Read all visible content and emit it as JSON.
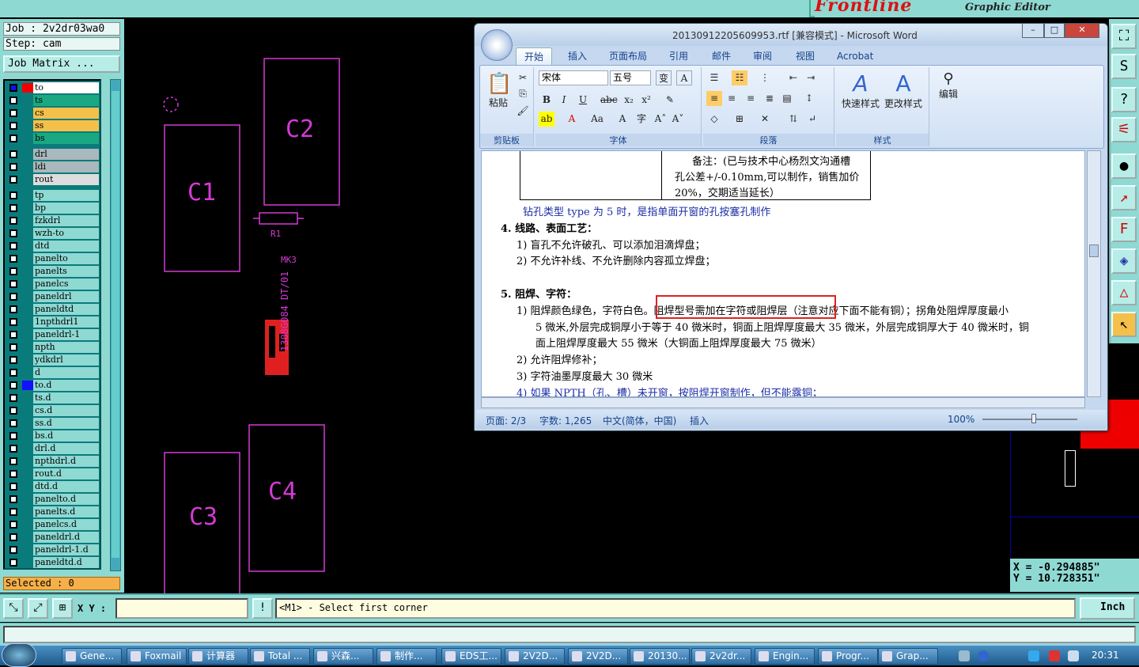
{
  "cam": {
    "job": "Job : 2v2dr03wa0",
    "step": "Step: cam",
    "job_matrix": "Job Matrix ...",
    "selected": "Selected : 0",
    "xy_label": "X Y :",
    "message": "<M1> - Select first corner",
    "unit": "Inch",
    "coord_x": "X = -0.294885\"",
    "coord_y": "Y = 10.728351\"",
    "brand": "Frontline",
    "brand_sub": "Graphic Editor",
    "layers": [
      {
        "name": "to",
        "color": "#ffffff"
      },
      {
        "name": "ts",
        "color": "#1aa883"
      },
      {
        "name": "cs",
        "color": "#f5c04a"
      },
      {
        "name": "ss",
        "color": "#f5c04a"
      },
      {
        "name": "bs",
        "color": "#1aa883"
      },
      {
        "name": "drl",
        "color": "#a9b8bc"
      },
      {
        "name": "ldi",
        "color": "#a9b8bc"
      },
      {
        "name": "rout",
        "color": "#dddddd"
      },
      {
        "name": "tp",
        "color": "#8fd9d3"
      },
      {
        "name": "bp",
        "color": "#8fd9d3"
      },
      {
        "name": "fzkdrl",
        "color": "#8fd9d3"
      },
      {
        "name": "wzh-to",
        "color": "#8fd9d3"
      },
      {
        "name": "dtd",
        "color": "#8fd9d3"
      },
      {
        "name": "panelto",
        "color": "#8fd9d3"
      },
      {
        "name": "panelts",
        "color": "#8fd9d3"
      },
      {
        "name": "panelcs",
        "color": "#8fd9d3"
      },
      {
        "name": "paneldrl",
        "color": "#8fd9d3"
      },
      {
        "name": "paneldtd",
        "color": "#8fd9d3"
      },
      {
        "name": "1npthdrl1",
        "color": "#8fd9d3"
      },
      {
        "name": "paneldrl-1",
        "color": "#8fd9d3"
      },
      {
        "name": "npth",
        "color": "#8fd9d3"
      },
      {
        "name": "ydkdrl",
        "color": "#8fd9d3"
      },
      {
        "name": "d",
        "color": "#8fd9d3"
      },
      {
        "name": "to.d",
        "color": "#8fd9d3"
      },
      {
        "name": "ts.d",
        "color": "#8fd9d3"
      },
      {
        "name": "cs.d",
        "color": "#8fd9d3"
      },
      {
        "name": "ss.d",
        "color": "#8fd9d3"
      },
      {
        "name": "bs.d",
        "color": "#8fd9d3"
      },
      {
        "name": "drl.d",
        "color": "#8fd9d3"
      },
      {
        "name": "npthdrl.d",
        "color": "#8fd9d3"
      },
      {
        "name": "rout.d",
        "color": "#8fd9d3"
      },
      {
        "name": "dtd.d",
        "color": "#8fd9d3"
      },
      {
        "name": "panelto.d",
        "color": "#8fd9d3"
      },
      {
        "name": "panelts.d",
        "color": "#8fd9d3"
      },
      {
        "name": "panelcs.d",
        "color": "#8fd9d3"
      },
      {
        "name": "paneldrl.d",
        "color": "#8fd9d3"
      },
      {
        "name": "paneldrl-1.d",
        "color": "#8fd9d3"
      },
      {
        "name": "paneldtd.d",
        "color": "#8fd9d3"
      }
    ],
    "pcb_labels": {
      "c1": "C1",
      "c2": "C2",
      "c3": "C3",
      "c4": "C4",
      "r1": "R1",
      "mk3": "MK3",
      "vert": "1308G084 DT/01"
    }
  },
  "word": {
    "title": "20130912205609953.rtf [兼容模式] - Microsoft Word",
    "tabs": [
      "开始",
      "插入",
      "页面布局",
      "引用",
      "邮件",
      "审阅",
      "视图",
      "Acrobat"
    ],
    "font_name": "宋体",
    "font_size": "五号",
    "groups": {
      "clipboard": "剪贴板",
      "font": "字体",
      "paragraph": "段落",
      "styles": "样式"
    },
    "paste": "粘贴",
    "quick_style": "快速样式",
    "change_style": "更改样式",
    "edit": "编辑",
    "doc": {
      "note1": "备注：(已与技术中心杨烈文沟通槽",
      "note2": "孔公差+/-0.10mm,可以制作，销售加价",
      "note3": "20%，交期适当延长）",
      "drill": "钻孔类型 type 为 5 时，是指单面开窗的孔按塞孔制作",
      "h4": "4.   线路、表面工艺：",
      "i41": "1)   盲孔不允许破孔、可以添加泪滴焊盘；",
      "i42": "2)   不允许补线、不允许删除内容孤立焊盘；",
      "h5": "5.   阻焊、字符：",
      "i51a": "1)   阻焊颜色绿色，字符白色。阻焊型号需加在字符或阻焊层（注意对应下面不能有铜）；拐角处阻焊厚度最小",
      "i51b": "5 微米,外层完成铜厚小于等于 40 微米时，铜面上阻焊厚度最大 35 微米，外层完成铜厚大于 40 微米时，铜",
      "i51c": "面上阻焊厚度最大 55 微米（大铜面上阻焊厚度最大 75 微米）",
      "i52": "2)   允许阻焊修补；",
      "i53": "3)   字符油墨厚度最大 30 微米",
      "i54": "4)   如果 NPTH（孔、槽）未开窗，按阻焊开窗制作，但不能露铜；"
    },
    "status": {
      "page": "页面: 2/3",
      "words": "字数: 1,265",
      "lang": "中文(简体，中国)",
      "mode": "插入",
      "zoom": "100%"
    }
  },
  "taskbar": {
    "items": [
      "Gene...",
      "Foxmail",
      "计算器",
      "Total ...",
      "兴森...",
      "制作...",
      "EDS工...",
      "2V2D...",
      "2V2D...",
      "20130...",
      "2v2dr...",
      "Engin...",
      "Progr...",
      "Grap..."
    ],
    "clock": "20:31"
  }
}
